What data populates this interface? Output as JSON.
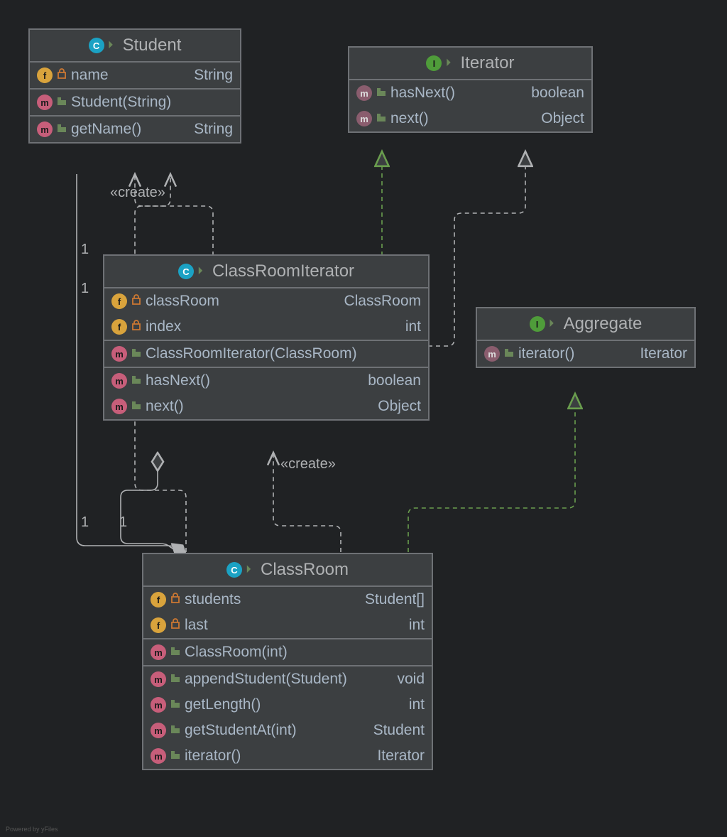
{
  "classes": {
    "student": {
      "name": "Student",
      "type": "class",
      "fields": [
        {
          "icon": "f",
          "vis": "private",
          "name": "name",
          "ret": "String"
        }
      ],
      "ctors": [
        {
          "icon": "m",
          "vis": "package",
          "name": "Student(String)",
          "ret": ""
        }
      ],
      "methods": [
        {
          "icon": "m",
          "vis": "package",
          "name": "getName()",
          "ret": "String"
        }
      ]
    },
    "iterator": {
      "name": "Iterator",
      "type": "interface",
      "methods": [
        {
          "icon": "mi",
          "vis": "package",
          "name": "hasNext()",
          "ret": "boolean"
        },
        {
          "icon": "mi",
          "vis": "package",
          "name": "next()",
          "ret": "Object"
        }
      ]
    },
    "classroomiterator": {
      "name": "ClassRoomIterator",
      "type": "class",
      "fields": [
        {
          "icon": "f",
          "vis": "private",
          "name": "classRoom",
          "ret": "ClassRoom"
        },
        {
          "icon": "f",
          "vis": "private",
          "name": "index",
          "ret": "int"
        }
      ],
      "ctors": [
        {
          "icon": "m",
          "vis": "package",
          "name": "ClassRoomIterator(ClassRoom)",
          "ret": ""
        }
      ],
      "methods": [
        {
          "icon": "m",
          "vis": "package",
          "name": "hasNext()",
          "ret": "boolean"
        },
        {
          "icon": "m",
          "vis": "package",
          "name": "next()",
          "ret": "Object"
        }
      ]
    },
    "aggregate": {
      "name": "Aggregate",
      "type": "interface",
      "methods": [
        {
          "icon": "mi",
          "vis": "package",
          "name": "iterator()",
          "ret": "Iterator"
        }
      ]
    },
    "classroom": {
      "name": "ClassRoom",
      "type": "class",
      "fields": [
        {
          "icon": "f",
          "vis": "private",
          "name": "students",
          "ret": "Student[]"
        },
        {
          "icon": "f",
          "vis": "private",
          "name": "last",
          "ret": "int"
        }
      ],
      "ctors": [
        {
          "icon": "m",
          "vis": "package",
          "name": "ClassRoom(int)",
          "ret": ""
        }
      ],
      "methods": [
        {
          "icon": "m",
          "vis": "package",
          "name": "appendStudent(Student)",
          "ret": "void"
        },
        {
          "icon": "m",
          "vis": "package",
          "name": "getLength()",
          "ret": "int"
        },
        {
          "icon": "m",
          "vis": "package",
          "name": "getStudentAt(int)",
          "ret": "Student"
        },
        {
          "icon": "m",
          "vis": "package",
          "name": "iterator()",
          "ret": "Iterator"
        }
      ]
    }
  },
  "labels": {
    "create1": "«create»",
    "create2": "«create»",
    "one_a": "1",
    "one_b": "1",
    "one_c": "1",
    "one_d": "1"
  },
  "footer": "Powered by yFiles"
}
